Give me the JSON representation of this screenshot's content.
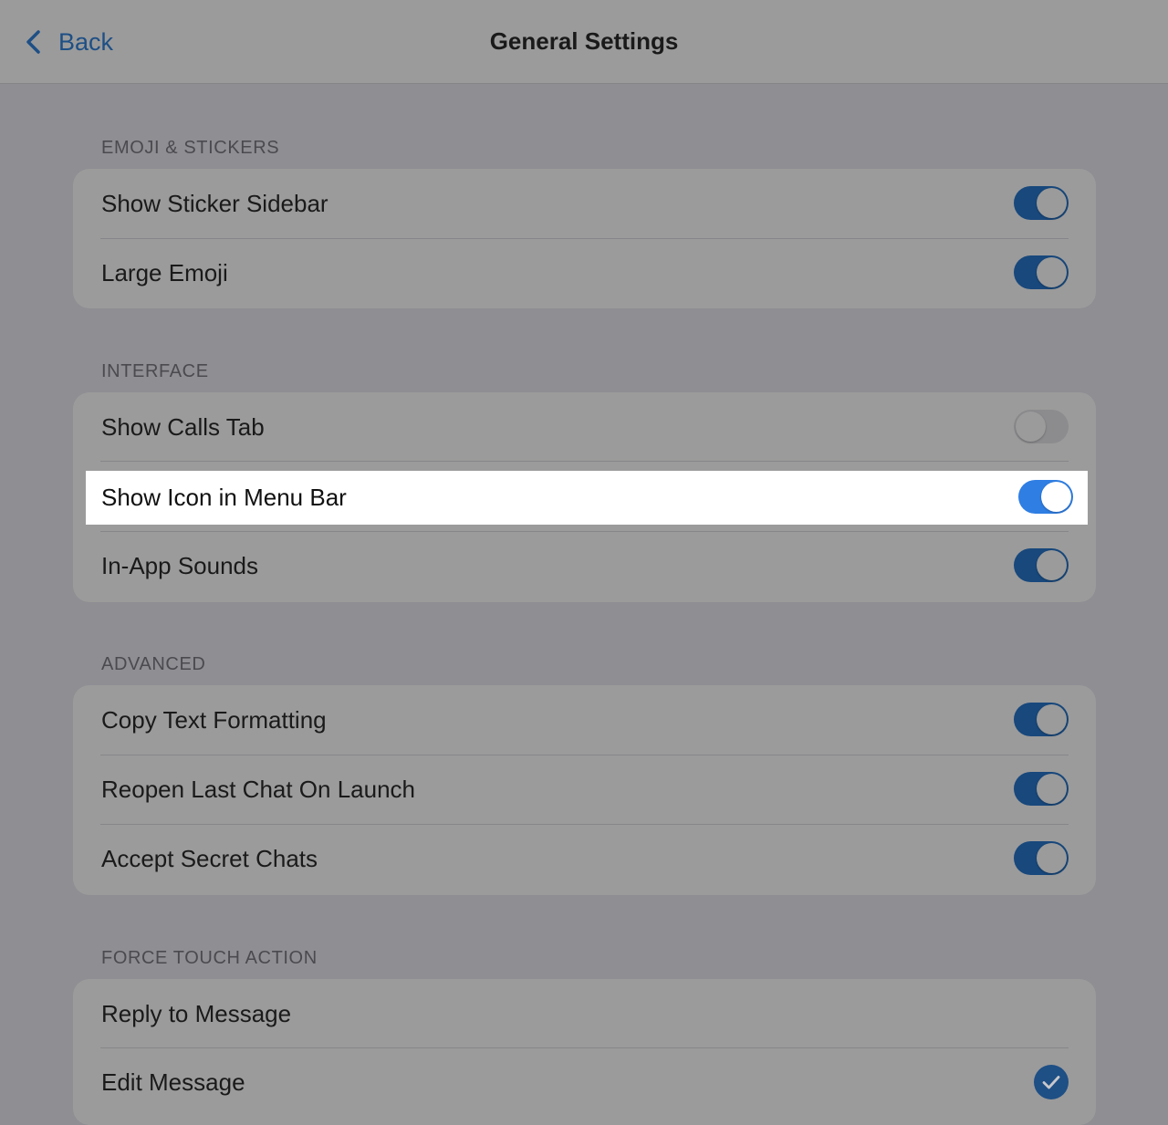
{
  "nav": {
    "back_label": "Back",
    "title": "General Settings"
  },
  "colors": {
    "accent_dimmed": "#18487c",
    "accent_active": "#2f7ee3",
    "back_link": "#1e4f85",
    "highlight_bg": "#ffffff",
    "dim_bg": "#8e8e93"
  },
  "sections": [
    {
      "header": "EMOJI & STICKERS",
      "rows": [
        {
          "label": "Show Sticker Sidebar",
          "on": true
        },
        {
          "label": "Large Emoji",
          "on": true
        }
      ]
    },
    {
      "header": "INTERFACE",
      "rows": [
        {
          "label": "Show Calls Tab",
          "on": false
        },
        {
          "label": "Show Icon in Menu Bar",
          "on": true,
          "highlighted": true
        },
        {
          "label": "In-App Sounds",
          "on": true
        }
      ]
    },
    {
      "header": "ADVANCED",
      "rows": [
        {
          "label": "Copy Text Formatting",
          "on": true
        },
        {
          "label": "Reopen Last Chat On Launch",
          "on": true
        },
        {
          "label": "Accept Secret Chats",
          "on": true
        }
      ]
    },
    {
      "header": "FORCE TOUCH ACTION",
      "rows": [
        {
          "label": "Reply to Message",
          "selected": false
        },
        {
          "label": "Edit Message",
          "selected": true
        }
      ]
    }
  ]
}
